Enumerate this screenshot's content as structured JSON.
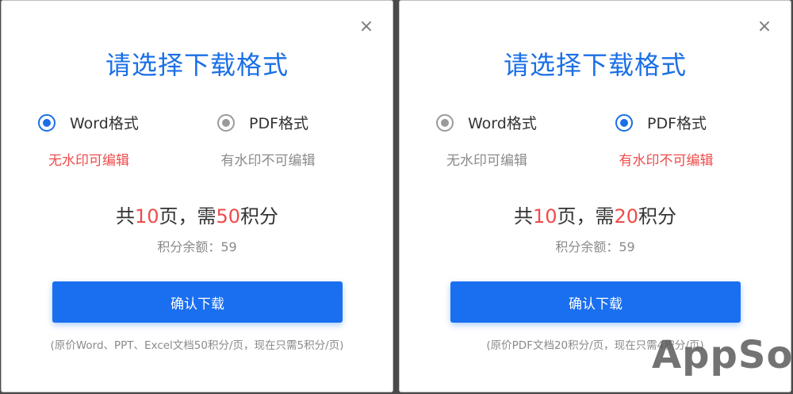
{
  "colors": {
    "accent": "#1a6fe6",
    "highlight": "#ef4b4b",
    "muted": "#8a8a8a"
  },
  "dialogs": [
    {
      "close_icon": "×",
      "title": "请选择下载格式",
      "options": [
        {
          "label": "Word格式",
          "selected": true,
          "note": "无水印可编辑",
          "note_color": "#ef4b4b"
        },
        {
          "label": "PDF格式",
          "selected": false,
          "note": "有水印不可编辑",
          "note_color": "#8a8a8a"
        }
      ],
      "summary": {
        "prefix": "共",
        "pages": "10",
        "mid": "页，需",
        "points": "50",
        "suffix": "积分"
      },
      "balance": "积分余额：59",
      "button": "确认下载",
      "footnote": "(原价Word、PPT、Excel文档50积分/页，现在只需5积分/页)"
    },
    {
      "close_icon": "×",
      "title": "请选择下载格式",
      "options": [
        {
          "label": "Word格式",
          "selected": false,
          "note": "无水印可编辑",
          "note_color": "#8a8a8a"
        },
        {
          "label": "PDF格式",
          "selected": true,
          "note": "有水印不可编辑",
          "note_color": "#ef4b4b"
        }
      ],
      "summary": {
        "prefix": "共",
        "pages": "10",
        "mid": "页，需",
        "points": "20",
        "suffix": "积分"
      },
      "balance": "积分余额：59",
      "button": "确认下载",
      "footnote": "(原价PDF文档20积分/页，现在只需4积分/页)"
    }
  ],
  "watermark": "AppSo"
}
